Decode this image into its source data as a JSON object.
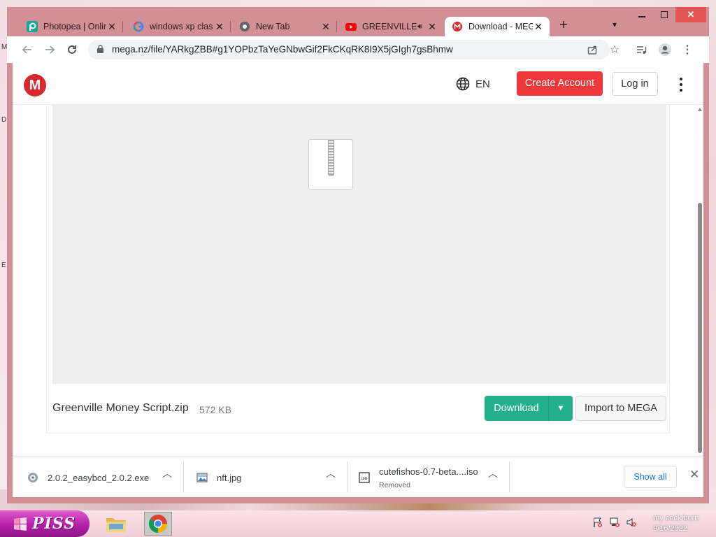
{
  "tabs": [
    {
      "title": "Photopea | Onlin",
      "favicon": "photopea-icon"
    },
    {
      "title": "windows xp clas",
      "favicon": "google-icon"
    },
    {
      "title": "New Tab",
      "favicon": "chrome-icon"
    },
    {
      "title": "GREENVILLE",
      "favicon": "youtube-icon"
    },
    {
      "title": "Download - MEG",
      "favicon": "mega-icon"
    }
  ],
  "address_bar": {
    "url": "mega.nz/file/YARkgZBB#g1YOPbzTaYeGNbwGif2FkCKqRK8I9X5jGIgh7gsBhmw"
  },
  "mega": {
    "logo": "M",
    "language": "EN",
    "create_account": "Create Account",
    "login": "Log in"
  },
  "file": {
    "name": "Greenville Money Script.zip",
    "size": "572 KB",
    "download_label": "Download",
    "import_label": "Import to MEGA"
  },
  "downloads": {
    "items": [
      {
        "name": "2.0.2_easybcd_2.0.2.exe",
        "status": "",
        "icon": "exe-file-icon"
      },
      {
        "name": "nft.jpg",
        "status": "",
        "icon": "image-file-icon"
      },
      {
        "name": "cutefishos-0.7-beta....iso",
        "status": "Removed",
        "icon": "iso-file-icon"
      }
    ],
    "show_all": "Show all"
  },
  "taskbar": {
    "start_label": "PISS",
    "clock_line1": "my cock burn",
    "clock_line2": "9/16/2022"
  },
  "colors": {
    "window_frame": "#d28f95",
    "mega_red": "#d9272e",
    "create_account": "#f0373a",
    "download_green": "#23b18b",
    "link_blue": "#1a73e8"
  }
}
